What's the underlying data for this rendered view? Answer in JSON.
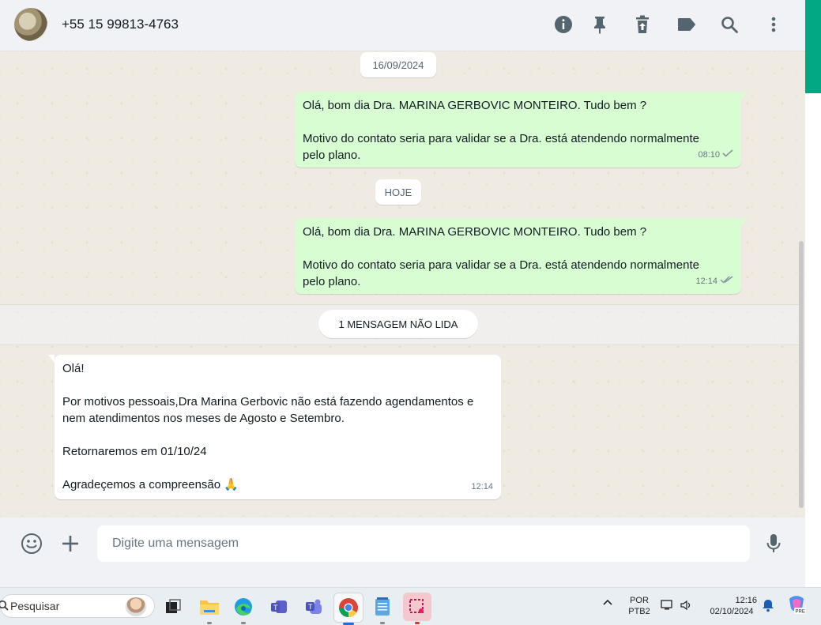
{
  "header": {
    "contact_name": "+55 15 99813-4763",
    "icons": [
      "info-icon",
      "pin-icon",
      "delete-icon",
      "label-icon",
      "search-icon",
      "more-options-icon"
    ]
  },
  "chat": {
    "date_1": "16/09/2024",
    "date_2": "HOJE",
    "messages": [
      {
        "direction": "outgoing",
        "lines": [
          "Olá, bom dia Dra. MARINA GERBOVIC MONTEIRO. Tudo bem ?",
          "",
          "Motivo do contato seria para validar se a Dra. está atendendo normalmente",
          "pelo plano."
        ],
        "time": "08:10",
        "status": "sent"
      },
      {
        "direction": "outgoing",
        "lines": [
          "Olá, bom dia Dra. MARINA GERBOVIC MONTEIRO. Tudo bem ?",
          "",
          "Motivo do contato seria para validar se a Dra. está atendendo normalmente",
          "pelo plano."
        ],
        "time": "12:14",
        "status": "delivered"
      },
      {
        "direction": "incoming",
        "lines": [
          "Olá!",
          "",
          "Por motivos pessoais,Dra Marina Gerbovic não está fazendo agendamentos e",
          "nem atendimentos nos meses de Agosto e Setembro.",
          "",
          "Retornaremos em 01/10/24",
          "",
          "Agradeçemos a compreensão 🙏"
        ],
        "time": "12:14"
      }
    ],
    "unread_label": "1 MENSAGEM NÃO LIDA"
  },
  "composer": {
    "placeholder": "Digite uma mensagem",
    "icons": [
      "emoji-icon",
      "attach-plus-icon",
      "microphone-icon"
    ]
  },
  "taskbar": {
    "search_label": "Pesquisar",
    "language_top": "POR",
    "language_bottom": "PTB2",
    "time": "12:16",
    "date": "02/10/2024"
  },
  "colors": {
    "accent_green": "#00a884",
    "outgoing_bubble": "#d9fdd3",
    "read_tick": "#53bdeb"
  }
}
